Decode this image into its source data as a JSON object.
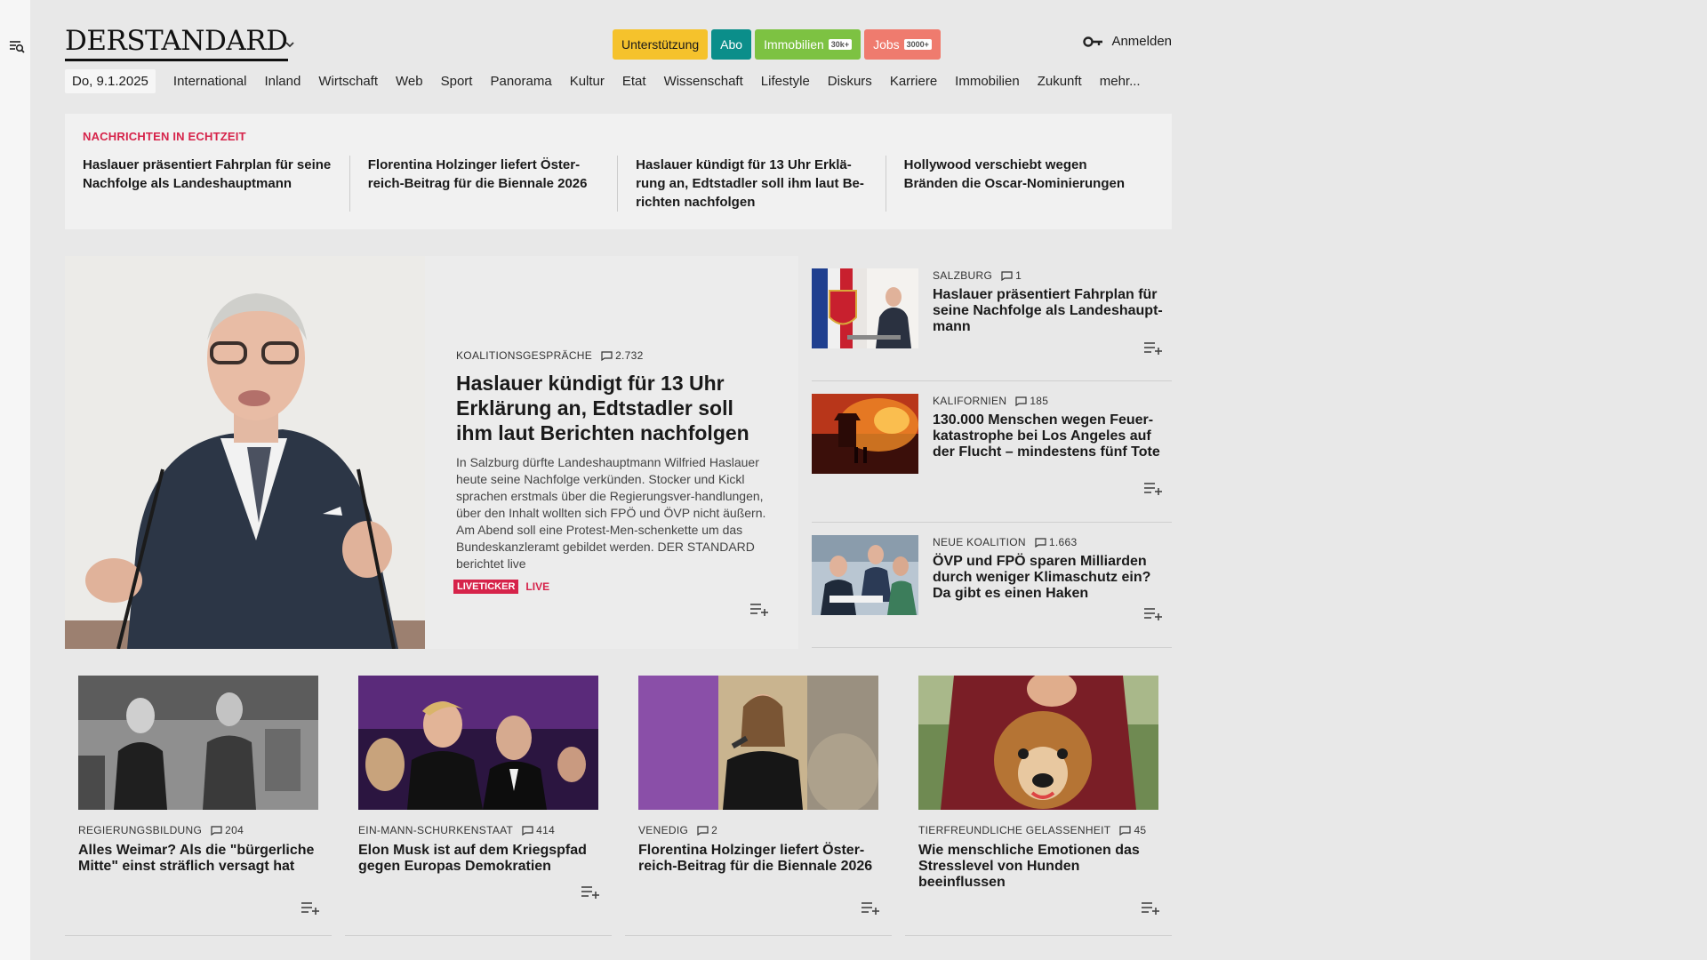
{
  "logo": "DERSTANDARD",
  "pills": {
    "support": "Unterstützung",
    "abo": "Abo",
    "immo": "Immobilien",
    "immo_badge": "30k+",
    "jobs": "Jobs",
    "jobs_badge": "3000+"
  },
  "login": "Anmelden",
  "nav": {
    "date": "Do, 9.1.2025",
    "items": [
      "International",
      "Inland",
      "Wirtschaft",
      "Web",
      "Sport",
      "Panorama",
      "Kultur",
      "Etat",
      "Wissenschaft",
      "Lifestyle",
      "Diskurs",
      "Karriere",
      "Immobilien",
      "Zukunft",
      "mehr..."
    ]
  },
  "realtime": {
    "label": "NACHRICHTEN IN ECHTZEIT",
    "items": [
      "Haslauer präsentiert Fahrplan für seine Nachfolge als Landeshauptmann",
      "Florentina Holzinger liefert Öster-reich-Beitrag für die Biennale 2026",
      "Haslauer kündigt für 13 Uhr Erklä-rung an, Edtstadler soll ihm laut Be-richten nachfolgen",
      "Hollywood verschiebt wegen Bränden die Oscar-Nominierungen"
    ]
  },
  "lead": {
    "kicker": "KOALITIONSGESPRÄCHE",
    "comments": "2.732",
    "title": "Haslauer kündigt für 13 Uhr Erklärung an, Edtstadler soll ihm laut Berichten nachfolgen",
    "teaser": "In Salzburg dürfte Landeshauptmann Wilfried Haslauer heute seine Nachfolge verkünden. Stocker und Kickl sprachen erstmals über die Regierungsver-handlungen, über den Inhalt wollten sich FPÖ und ÖVP nicht äußern. Am Abend soll eine Protest-Men-schenkette um das Bundeskanzleramt gebildet werden. DER STANDARD berichtet live",
    "live_badge": "LIVETICKER",
    "live_text": "LIVE"
  },
  "side": [
    {
      "kicker": "SALZBURG",
      "comments": "1",
      "title": "Haslauer präsentiert Fahrplan für seine Nachfolge als Landeshaupt-mann"
    },
    {
      "kicker": "KALIFORNIEN",
      "comments": "185",
      "title": "130.000 Menschen wegen Feuer-katastrophe bei Los Angeles auf der Flucht – mindestens fünf Tote"
    },
    {
      "kicker": "NEUE KOALITION",
      "comments": "1.663",
      "title": "ÖVP und FPÖ sparen Milliarden durch weniger Klimaschutz ein? Da gibt es einen Haken"
    }
  ],
  "cards": [
    {
      "kicker": "REGIERUNGSBILDUNG",
      "comments": "204",
      "title": "Alles Weimar? Als die \"bürgerliche Mitte\" einst sträflich versagt hat"
    },
    {
      "kicker": "EIN-MANN-SCHURKENSTAAT",
      "comments": "414",
      "title": "Elon Musk ist auf dem Kriegspfad gegen Europas Demokratien"
    },
    {
      "kicker": "VENEDIG",
      "comments": "2",
      "title": "Florentina Holzinger liefert Öster-reich-Beitrag für die Biennale 2026"
    },
    {
      "kicker": "TIERFREUNDLICHE GELASSENHEIT",
      "comments": "45",
      "title": "Wie menschliche Emotionen das Stresslevel von Hunden beeinflussen"
    }
  ],
  "colors": {
    "accent_red": "#d6234a",
    "support": "#f5c22c",
    "abo": "#0b8e8a",
    "immo": "#7dc242",
    "jobs": "#ef7b6e"
  }
}
